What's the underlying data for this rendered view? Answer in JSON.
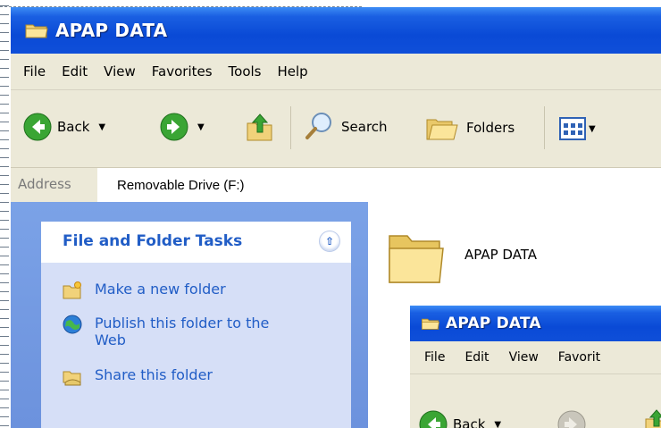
{
  "window": {
    "title": "APAP DATA"
  },
  "menu": [
    "File",
    "Edit",
    "View",
    "Favorites",
    "Tools",
    "Help"
  ],
  "toolbar": {
    "back": "Back",
    "search": "Search",
    "folders": "Folders"
  },
  "address": {
    "label": "Address",
    "value": "Removable Drive (F:)"
  },
  "tasks_panel": {
    "title": "File and Folder Tasks",
    "items": [
      {
        "label": "Make a new folder",
        "icon": "new-folder-icon"
      },
      {
        "label": "Publish this folder to the Web",
        "icon": "publish-web-icon"
      },
      {
        "label": "Share this folder",
        "icon": "share-folder-icon"
      }
    ]
  },
  "content": {
    "folder_name": "APAP DATA"
  },
  "second_window": {
    "title": "APAP DATA",
    "menu": [
      "File",
      "Edit",
      "View",
      "Favorit"
    ],
    "back": "Back"
  },
  "colors": {
    "titlebar": "#0a4ad6",
    "menubar": "#ece9d8",
    "sidebar": "#6c92dd",
    "panel": "#d6dff7",
    "link": "#215dc6"
  }
}
